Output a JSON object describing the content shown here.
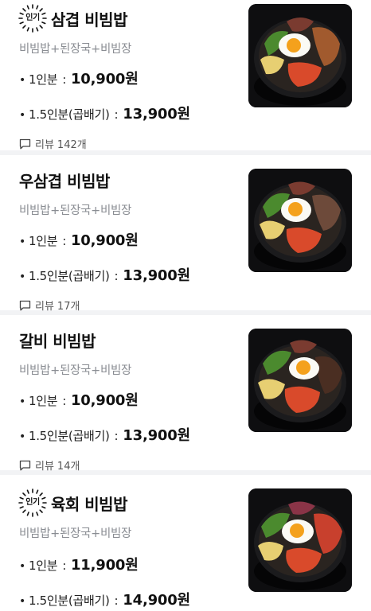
{
  "menu": [
    {
      "badge": "인기",
      "title": "삼겹 비빔밥",
      "description": "비빔밥+된장국+비빔장",
      "prices": [
        {
          "label": "1인분",
          "price": "10,900원"
        },
        {
          "label": "1.5인분(곱배기)",
          "price": "13,900원"
        }
      ],
      "review_label": "리뷰",
      "review_count": "142개",
      "image": "samgyeop-bibimbap-photo"
    },
    {
      "badge": null,
      "title": "우삼겹 비빔밥",
      "description": "비빔밥+된장국+비빔장",
      "prices": [
        {
          "label": "1인분",
          "price": "10,900원"
        },
        {
          "label": "1.5인분(곱배기)",
          "price": "13,900원"
        }
      ],
      "review_label": "리뷰",
      "review_count": "17개",
      "image": "usamgyeop-bibimbap-photo"
    },
    {
      "badge": null,
      "title": "갈비 비빔밥",
      "description": "비빔밥+된장국+비빔장",
      "prices": [
        {
          "label": "1인분",
          "price": "10,900원"
        },
        {
          "label": "1.5인분(곱배기)",
          "price": "13,900원"
        }
      ],
      "review_label": "리뷰",
      "review_count": "14개",
      "image": "galbi-bibimbap-photo"
    },
    {
      "badge": "인기",
      "title": "육회 비빔밥",
      "description": "비빔밥+된장국+비빔장",
      "prices": [
        {
          "label": "1인분",
          "price": "11,900원"
        },
        {
          "label": "1.5인분(곱배기)",
          "price": "14,900원"
        }
      ],
      "image": "yukhoe-bibimbap-photo"
    }
  ],
  "separators": {
    "bullet": "•",
    "colon": ":"
  },
  "icons": {
    "review": "chat-bubble-icon",
    "badge": "sunburst-badge-icon"
  },
  "colors": {
    "title": "#111111",
    "description": "#8a8d93",
    "divider": "#f2f3f5",
    "egg_yolk": "#f4a11c",
    "kimchi": "#d94a2b"
  }
}
